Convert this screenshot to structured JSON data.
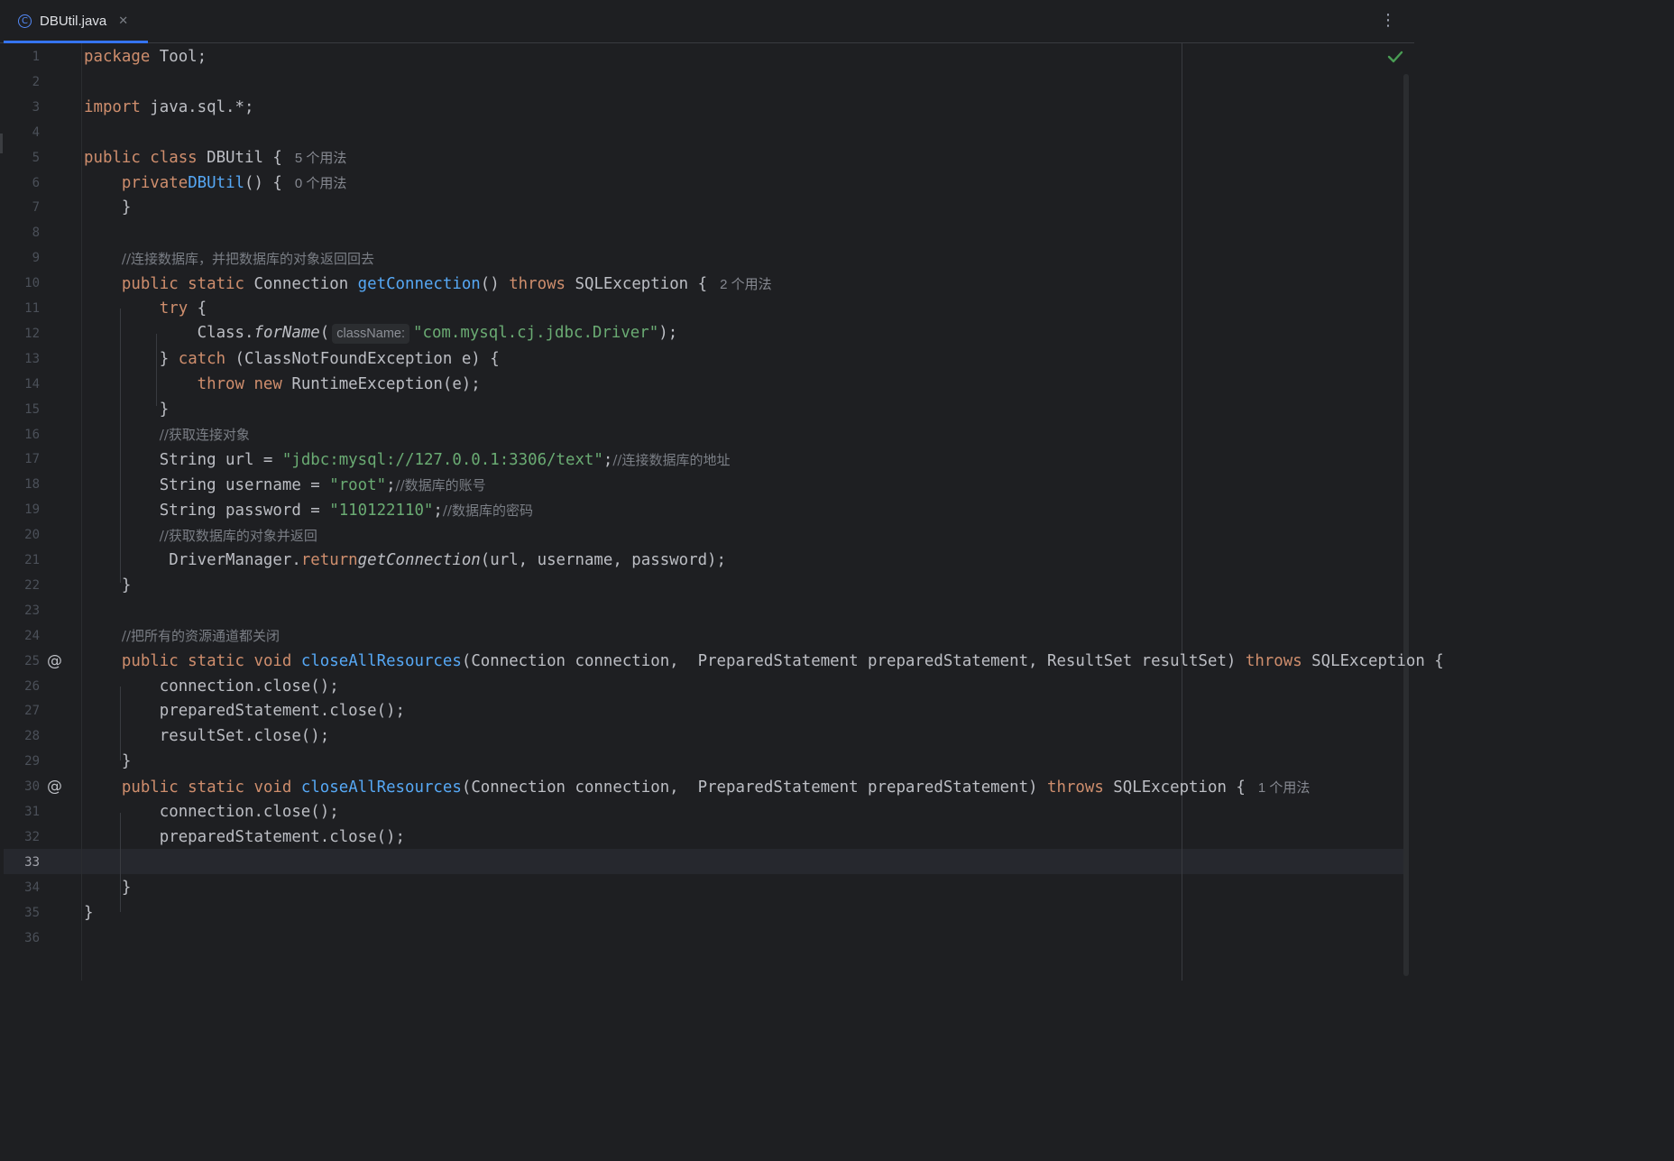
{
  "tab": {
    "icon": "class-c-icon",
    "title": "DBUtil.java",
    "close": "✕"
  },
  "menu": {
    "more": "⋮"
  },
  "status": {
    "inspection": "check-icon",
    "color": "#499c54"
  },
  "editor": {
    "current_line": 33,
    "lines": [
      {
        "n": "1"
      },
      {
        "n": "2"
      },
      {
        "n": "3"
      },
      {
        "n": "4"
      },
      {
        "n": "5"
      },
      {
        "n": "6"
      },
      {
        "n": "7"
      },
      {
        "n": "8"
      },
      {
        "n": "9"
      },
      {
        "n": "10"
      },
      {
        "n": "11"
      },
      {
        "n": "12"
      },
      {
        "n": "13"
      },
      {
        "n": "14"
      },
      {
        "n": "15"
      },
      {
        "n": "16"
      },
      {
        "n": "17"
      },
      {
        "n": "18"
      },
      {
        "n": "19"
      },
      {
        "n": "20"
      },
      {
        "n": "21"
      },
      {
        "n": "22"
      },
      {
        "n": "23"
      },
      {
        "n": "24"
      },
      {
        "n": "25"
      },
      {
        "n": "26"
      },
      {
        "n": "27"
      },
      {
        "n": "28"
      },
      {
        "n": "29"
      },
      {
        "n": "30"
      },
      {
        "n": "31"
      },
      {
        "n": "32"
      },
      {
        "n": "33"
      },
      {
        "n": "34"
      },
      {
        "n": "35"
      },
      {
        "n": "36"
      }
    ],
    "code": {
      "l1": {
        "kw": "package",
        "rest": " Tool;"
      },
      "l3": {
        "kw": "import",
        "rest": " java.sql.*;"
      },
      "l5": {
        "kw": "public class",
        "rest": " DBUtil {",
        "hint": "5 个用法"
      },
      "l6": {
        "indent": "    ",
        "kw": "private",
        "fn": "DBUtil",
        "rest": "() {",
        "hint": "0 个用法"
      },
      "l7": {
        "text": "    }"
      },
      "l9": {
        "indent": "    ",
        "comment": "//连接数据库，并把数据库的对象返回回去"
      },
      "l10": {
        "indent": "    ",
        "kw1": "public static",
        "mid": " Connection ",
        "fn": "getConnection",
        "paren": "() ",
        "kw2": "throws",
        "rest": " SQLException {",
        "hint": "2 个用法"
      },
      "l11": {
        "indent": "        ",
        "kw": "try",
        "rest": " {"
      },
      "l12": {
        "indent": "            ",
        "pre": "Class.",
        "method": "forName",
        "open": "(",
        "param": "className:",
        "str": "\"com.mysql.cj.jdbc.Driver\"",
        "rest": ");"
      },
      "l13": {
        "indent": "        ",
        "pre": "} ",
        "kw": "catch",
        "rest": " (ClassNotFoundException e) {"
      },
      "l14": {
        "indent": "            ",
        "kw": "throw new",
        "rest": " RuntimeException(e);"
      },
      "l15": {
        "text": "        }"
      },
      "l16": {
        "indent": "        ",
        "comment": "//获取连接对象"
      },
      "l17": {
        "indent": "        ",
        "pre": "String url = ",
        "str": "\"jdbc:mysql://127.0.0.1:3306/text\"",
        "semi": ";",
        "comment": "//连接数据库的地址"
      },
      "l18": {
        "indent": "        ",
        "pre": "String username = ",
        "str": "\"root\"",
        "semi": ";",
        "comment": "//数据库的账号"
      },
      "l19": {
        "indent": "        ",
        "pre": "String password = ",
        "str": "\"110122110\"",
        "semi": ";",
        "comment": "//数据库的密码"
      },
      "l20": {
        "indent": "        ",
        "comment": "//获取数据库的对象并返回"
      },
      "l21": {
        "indent": "        ",
        "kw": "return",
        "pre": " DriverManager.",
        "method": "getConnection",
        "rest": "(url, username, password);"
      },
      "l22": {
        "text": "    }"
      },
      "l24": {
        "indent": "    ",
        "comment": "//把所有的资源通道都关闭"
      },
      "l25": {
        "indent": "    ",
        "kw1": "public static void",
        "mid": " ",
        "fn": "closeAllResources",
        "params": "(Connection connection,  PreparedStatement preparedStatement, ResultSet resultSet) ",
        "kw2": "throws",
        "rest": " SQLException {"
      },
      "l26": {
        "text": "        connection.close();"
      },
      "l27": {
        "text": "        preparedStatement.close();"
      },
      "l28": {
        "text": "        resultSet.close();"
      },
      "l29": {
        "text": "    }"
      },
      "l30": {
        "indent": "    ",
        "kw1": "public static void",
        "mid": " ",
        "fn": "closeAllResources",
        "params": "(Connection connection,  PreparedStatement preparedStatement) ",
        "kw2": "throws",
        "rest": " SQLException {",
        "hint": "1 个用法"
      },
      "l31": {
        "text": "        connection.close();"
      },
      "l32": {
        "text": "        preparedStatement.close();"
      },
      "l34": {
        "text": "    }"
      },
      "l35": {
        "text": "}"
      }
    },
    "gutter_icons": {
      "l25": "@",
      "l30": "@"
    }
  }
}
